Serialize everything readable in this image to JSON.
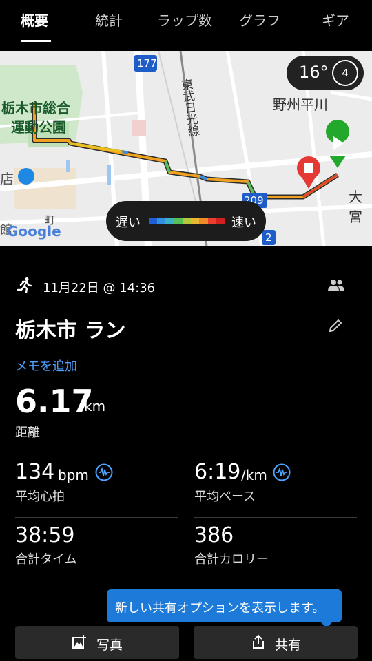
{
  "tabs": [
    {
      "label": "概要",
      "active": true
    },
    {
      "label": "統計"
    },
    {
      "label": "ラップ数"
    },
    {
      "label": "グラフ"
    },
    {
      "label": "ギア"
    }
  ],
  "map": {
    "temperature": "16°",
    "wind": "4",
    "labels": {
      "park": "栃木市総合\n運動公園",
      "park_line1": "栃木市総合",
      "park_line2": "運動公園",
      "station": "野州平川",
      "railway": "東武日光線",
      "road_177": "177",
      "road_209": "209",
      "road_2": "2",
      "store": "店",
      "town": "町",
      "omiya": "大宮",
      "google": "Google",
      "kan": "館"
    },
    "legend": {
      "slow": "遅い",
      "fast": "速い",
      "colors": [
        "#1f5fd6",
        "#2f8fe0",
        "#3bb0c8",
        "#58c058",
        "#b4c83a",
        "#e8b830",
        "#f08a2a",
        "#e8402c",
        "#d42020"
      ]
    }
  },
  "activity": {
    "datetime": "11月22日 @ 14:36",
    "title": "栃木市 ラン",
    "add_memo": "メモを追加",
    "distance": {
      "value": "6.17",
      "unit": "km",
      "label": "距離"
    },
    "stats": [
      {
        "value": "134",
        "unit": "bpm",
        "label": "平均心拍",
        "icon": "heart-rate-wave-icon"
      },
      {
        "value": "6:19",
        "unit": "/km",
        "label": "平均ペース",
        "icon": "pace-wave-icon"
      },
      {
        "value": "38:59",
        "unit": "",
        "label": "合計タイム"
      },
      {
        "value": "386",
        "unit": "",
        "label": "合計カロリー"
      }
    ]
  },
  "tooltip": {
    "text": "新しい共有オプションを表示します。"
  },
  "buttons": {
    "photo": "写真",
    "share": "共有"
  },
  "colors": {
    "accent": "#4da3ff",
    "tooltip": "#1e7ad8",
    "start": "#22a82a",
    "stop": "#e53935"
  }
}
